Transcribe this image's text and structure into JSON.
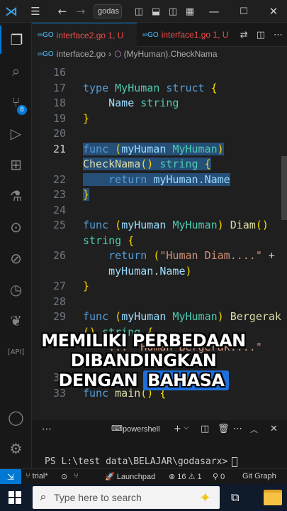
{
  "titlebar": {
    "command_center": "godas",
    "icons": [
      "vscode-logo",
      "menu-icon",
      "back-arrow-icon",
      "forward-arrow-icon",
      "layout-sidebar-icon",
      "layout-panel-icon",
      "layout-split-icon",
      "customize-layout-icon",
      "minimize-icon",
      "maximize-icon",
      "close-icon"
    ]
  },
  "activity": {
    "scm_badge": "8"
  },
  "tabs": [
    {
      "label": "interface2.go",
      "problems": "1, U",
      "active": true
    },
    {
      "label": "interface1.go",
      "problems": "1, U",
      "active": false
    }
  ],
  "breadcrumb": {
    "file": "interface2.go",
    "symbol": "(MyHuman).CheckNama"
  },
  "editor": {
    "lines": [
      {
        "n": "16",
        "tokens": []
      },
      {
        "n": "17",
        "tokens": [
          [
            "kw",
            "type "
          ],
          [
            "ty",
            "MyHuman "
          ],
          [
            "kw",
            "struct "
          ],
          [
            "pn",
            "{"
          ]
        ]
      },
      {
        "n": "18",
        "tokens": [
          [
            "",
            "    "
          ],
          [
            "id",
            "Name "
          ],
          [
            "ty",
            "string"
          ]
        ]
      },
      {
        "n": "19",
        "tokens": [
          [
            "pn",
            "}"
          ]
        ]
      },
      {
        "n": "20",
        "tokens": []
      },
      {
        "n": "21",
        "tokens": [
          [
            "kw",
            "func "
          ],
          [
            "pn",
            "("
          ],
          [
            "id",
            "myHuman "
          ],
          [
            "ty",
            "MyHuman"
          ],
          [
            "pn",
            ")"
          ]
        ],
        "selected": true,
        "current": true
      },
      {
        "n": "",
        "tokens": [
          [
            "fn",
            "CheckNama"
          ],
          [
            "pn",
            "() "
          ],
          [
            "ty",
            "string "
          ],
          [
            "pn",
            "{"
          ]
        ],
        "selected": true
      },
      {
        "n": "22",
        "tokens": [
          [
            "",
            "    "
          ],
          [
            "kw",
            "return "
          ],
          [
            "id",
            "myHuman"
          ],
          [
            "",
            "."
          ],
          [
            "id",
            "Name"
          ]
        ],
        "selected": true
      },
      {
        "n": "23",
        "tokens": [
          [
            "pn",
            "}"
          ]
        ],
        "selected": true
      },
      {
        "n": "24",
        "tokens": []
      },
      {
        "n": "25",
        "tokens": [
          [
            "kw",
            "func "
          ],
          [
            "pn",
            "("
          ],
          [
            "id",
            "myHuman "
          ],
          [
            "ty",
            "MyHuman"
          ],
          [
            "pn",
            ") "
          ],
          [
            "fn",
            "Diam"
          ],
          [
            "pn",
            "()"
          ]
        ]
      },
      {
        "n": "",
        "tokens": [
          [
            "ty",
            "string "
          ],
          [
            "pn",
            "{"
          ]
        ]
      },
      {
        "n": "26",
        "tokens": [
          [
            "",
            "    "
          ],
          [
            "kw",
            "return "
          ],
          [
            "pn",
            "("
          ],
          [
            "st",
            "\"Human Diam....\" "
          ],
          [
            "",
            "+"
          ]
        ]
      },
      {
        "n": "",
        "tokens": [
          [
            "",
            "    "
          ],
          [
            "id",
            "myHuman"
          ],
          [
            "",
            "."
          ],
          [
            "id",
            "Name"
          ],
          [
            "pn",
            ")"
          ]
        ]
      },
      {
        "n": "27",
        "tokens": [
          [
            "pn",
            "}"
          ]
        ]
      },
      {
        "n": "28",
        "tokens": []
      },
      {
        "n": "29",
        "tokens": [
          [
            "kw",
            "func "
          ],
          [
            "pn",
            "("
          ],
          [
            "id",
            "myHuman "
          ],
          [
            "ty",
            "MyHuman"
          ],
          [
            "pn",
            ") "
          ],
          [
            "fn",
            "Bergerak"
          ]
        ]
      },
      {
        "n": "",
        "tokens": [
          [
            "pn",
            "() "
          ],
          [
            "ty",
            "string "
          ],
          [
            "pn",
            "{"
          ]
        ]
      },
      {
        "n": "",
        "tokens": [
          [
            "",
            "    "
          ],
          [
            "st",
            "... \"Human Bergerak....\""
          ]
        ]
      },
      {
        "n": "",
        "tokens": []
      },
      {
        "n": "32",
        "tokens": []
      },
      {
        "n": "33",
        "tokens": [
          [
            "kw",
            "func "
          ],
          [
            "fn",
            "main"
          ],
          [
            "pn",
            "() {"
          ]
        ]
      }
    ]
  },
  "caption": {
    "line1": "MEMILIKI PERBEDAAN",
    "line2": "DIBANDINGKAN",
    "line3_plain": "DENGAN ",
    "line3_highlight": "BAHASA"
  },
  "panel": {
    "terminal_name": "powershell",
    "prompt": "PS L:\\test data\\BELAJAR\\godasarx>"
  },
  "statusbar": {
    "branch": "trial*",
    "launchpad": "Launchpad",
    "errors": "16",
    "warnings": "1",
    "ports": "0",
    "gitgraph": "Git Graph"
  },
  "taskbar": {
    "search_placeholder": "Type here to search"
  },
  "colors": {
    "accent": "#0078d4",
    "selection": "#264f78",
    "keyword": "#569cd6",
    "type": "#4ec9b0",
    "function": "#dcdcaa",
    "string": "#ce9178",
    "error": "#f14c4c"
  }
}
